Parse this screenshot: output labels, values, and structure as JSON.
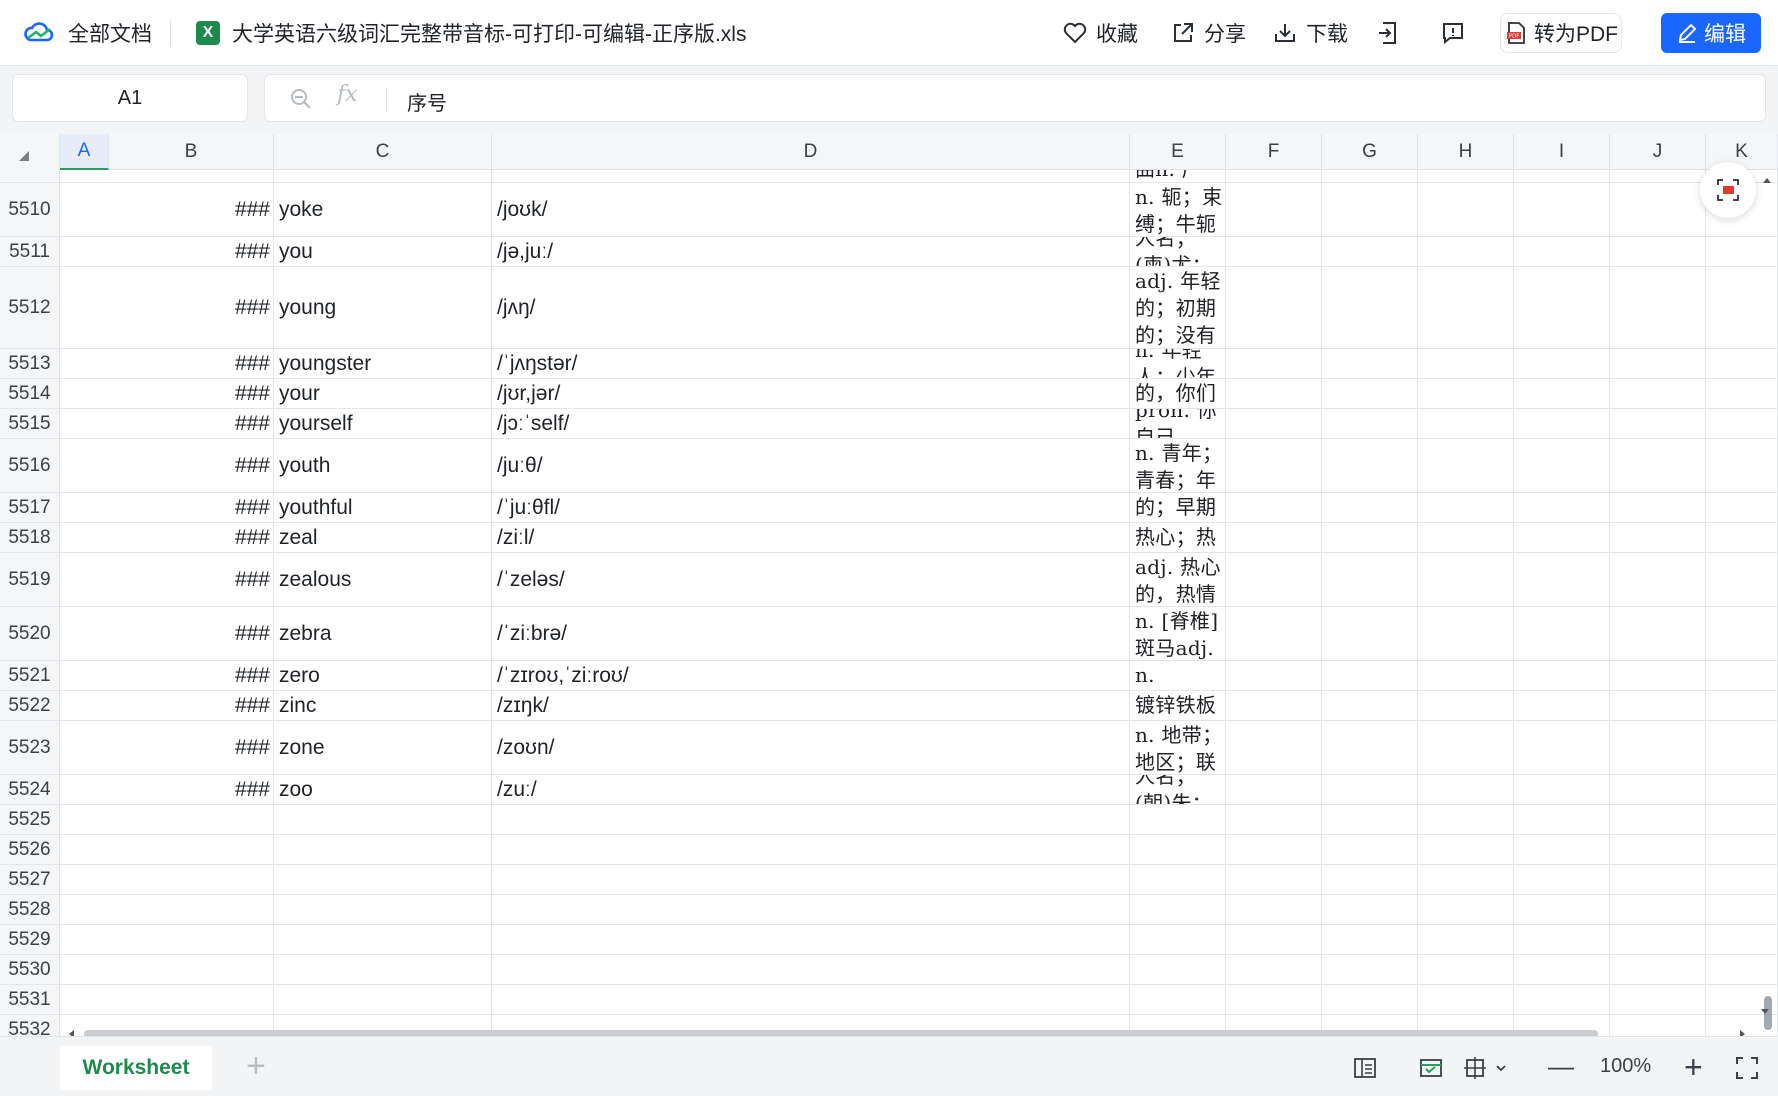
{
  "topbar": {
    "home_label": "全部文档",
    "file_icon": "X",
    "file_title": "大学英语六级词汇完整带音标-可打印-可编辑-正序版.xls",
    "collect_label": "收藏",
    "share_label": "分享",
    "download_label": "下载",
    "to_pdf_label": "转为PDF",
    "edit_label": "编辑",
    "pdf_badge": "PDF"
  },
  "formula_bar": {
    "cell_ref": "A1",
    "fx_label": "fx",
    "value": "序号"
  },
  "columns": [
    "A",
    "B",
    "C",
    "D",
    "E",
    "F",
    "G",
    "H",
    "I",
    "J",
    "K"
  ],
  "partial_top_text": "曲n. 产量；利润，红利率",
  "rows": [
    {
      "num": "5510",
      "a": "###",
      "b": "yoke",
      "c": "/joʊk/",
      "d": "n. 轭；束缚；牛轭vt. 结合；给…上轭vi. 结合；匹配n. (Yoke)人名；(日)与家(姓)"
    },
    {
      "num": "5511",
      "a": "###",
      "b": "you",
      "c": "/jə,juː/",
      "d": "pron. 你；你们n. (You)人名；(柬)尤；(东南亚国家华语)猷"
    },
    {
      "num": "5512",
      "a": "###",
      "b": "young",
      "c": "/jʌŋ/",
      "d": "adj. 年轻的；初期的；没有经验的n. 年轻人；（动物的）崽，仔n. (Young)人名；(中)杨(广东话・威妥玛)；(柬)永；(英、葡)扬"
    },
    {
      "num": "5513",
      "a": "###",
      "b": "youngster",
      "c": "/ˈjʌŋstər/",
      "d": "n. 年轻人；少年"
    },
    {
      "num": "5514",
      "a": "###",
      "b": "your",
      "c": "/jʊr,jər/",
      "d": "pron. 你的，你们的"
    },
    {
      "num": "5515",
      "a": "###",
      "b": "yourself",
      "c": "/jɔːˈself/",
      "d": "pron. 你自己"
    },
    {
      "num": "5516",
      "a": "###",
      "b": "youth",
      "c": "/juːθ/",
      "d": "n. 青年；青春；年轻；青少年时期n. (Youth)《芳华》（电影名）"
    },
    {
      "num": "5517",
      "a": "###",
      "b": "youthful",
      "c": "/ˈjuːθfl/",
      "d": "adj. 年轻的；早期的"
    },
    {
      "num": "5518",
      "a": "###",
      "b": "zeal",
      "c": "/ziːl/",
      "d": "n. 热情；热心；热诚"
    },
    {
      "num": "5519",
      "a": "###",
      "b": "zealous",
      "c": "/ˈzeləs/",
      "d": "adj. 热心的，热情的，积极的n. (Zealous)人名；(英)泽勒斯"
    },
    {
      "num": "5520",
      "a": "###",
      "b": "zebra",
      "c": "/ˈziːbrə/",
      "d": "n. [脊椎] 斑马adj. 有斑纹的（Zebra）斑马（文具品牌）；斑马公司（指盈利性和有责任感的公司）"
    },
    {
      "num": "5521",
      "a": "###",
      "b": "zero",
      "c": "/ˈzɪroʊ,ˈziːroʊ/",
      "d": "n. 零点，零度num. 零n. (Zero)人名；(意)泽罗"
    },
    {
      "num": "5522",
      "a": "###",
      "b": "zinc",
      "c": "/zɪŋk/",
      "d": "n. 锌；（用于屋顶等的）镀锌铁板v. 镀锌于，用锌处理"
    },
    {
      "num": "5523",
      "a": "###",
      "b": "zone",
      "c": "/zoʊn/",
      "d": "n. 地带；地区；联防vi. 分成区vt. 使分成地带；环绕n. (Zone)人名；(塞)佐内"
    },
    {
      "num": "5524",
      "a": "###",
      "b": "zoo",
      "c": "/zuː/",
      "d": "n. 动物园n. (Zoo)人名；(朝)朱；(阿拉伯)祖"
    },
    {
      "num": "5525",
      "a": "",
      "b": "",
      "c": "",
      "d": ""
    },
    {
      "num": "5526",
      "a": "",
      "b": "",
      "c": "",
      "d": ""
    },
    {
      "num": "5527",
      "a": "",
      "b": "",
      "c": "",
      "d": ""
    },
    {
      "num": "5528",
      "a": "",
      "b": "",
      "c": "",
      "d": ""
    },
    {
      "num": "5529",
      "a": "",
      "b": "",
      "c": "",
      "d": ""
    },
    {
      "num": "5530",
      "a": "",
      "b": "",
      "c": "",
      "d": ""
    },
    {
      "num": "5531",
      "a": "",
      "b": "",
      "c": "",
      "d": ""
    },
    {
      "num": "5532",
      "a": "",
      "b": "",
      "c": "",
      "d": ""
    }
  ],
  "bottom": {
    "sheet_tab": "Worksheet",
    "add_sheet": "+",
    "zoom": "100%",
    "zoom_out": "—",
    "zoom_in": "+"
  },
  "colors": {
    "accent": "#1a66ff",
    "excel_green": "#1e8a4c",
    "grid_line": "#e3e5e8"
  }
}
